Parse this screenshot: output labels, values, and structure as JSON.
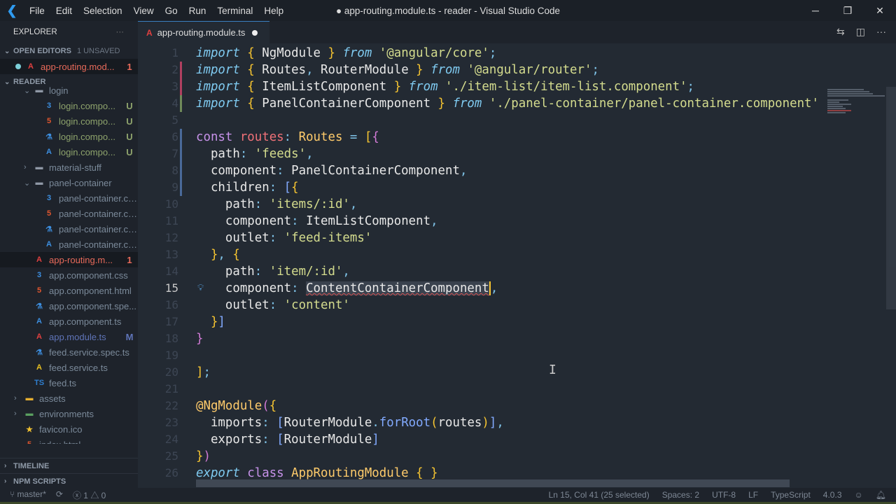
{
  "window": {
    "title": "● app-routing.module.ts - reader - Visual Studio Code",
    "menu": [
      "File",
      "Edit",
      "Selection",
      "View",
      "Go",
      "Run",
      "Terminal",
      "Help"
    ]
  },
  "sidebar": {
    "title": "EXPLORER",
    "more": "···",
    "open_editors": {
      "label": "OPEN EDITORS",
      "badge": "1 UNSAVED",
      "item": {
        "name": "app-routing.mod...",
        "problems": "1"
      }
    },
    "reader_label": "READER",
    "items": [
      {
        "name": "login",
        "indent": 2,
        "type": "folder-open",
        "cls": ""
      },
      {
        "name": "login.compo...",
        "indent": 3,
        "type": "css",
        "status": "U",
        "cls": "untr"
      },
      {
        "name": "login.compo...",
        "indent": 3,
        "type": "html",
        "status": "U",
        "cls": "untr"
      },
      {
        "name": "login.compo...",
        "indent": 3,
        "type": "spec",
        "status": "U",
        "cls": "untr"
      },
      {
        "name": "login.compo...",
        "indent": 3,
        "type": "ng",
        "status": "U",
        "cls": "untr"
      },
      {
        "name": "material-stuff",
        "indent": 2,
        "type": "folder",
        "cls": ""
      },
      {
        "name": "panel-container",
        "indent": 2,
        "type": "folder-open",
        "cls": ""
      },
      {
        "name": "panel-container.co...",
        "indent": 3,
        "type": "css",
        "cls": ""
      },
      {
        "name": "panel-container.co...",
        "indent": 3,
        "type": "html",
        "cls": ""
      },
      {
        "name": "panel-container.co...",
        "indent": 3,
        "type": "spec",
        "cls": ""
      },
      {
        "name": "panel-container.co...",
        "indent": 3,
        "type": "ng",
        "cls": ""
      },
      {
        "name": "app-routing.m...",
        "indent": 2,
        "type": "ngred",
        "status": "1",
        "cls": "err",
        "selected": true
      },
      {
        "name": "app.component.css",
        "indent": 2,
        "type": "css",
        "cls": ""
      },
      {
        "name": "app.component.html",
        "indent": 2,
        "type": "html",
        "cls": ""
      },
      {
        "name": "app.component.spe...",
        "indent": 2,
        "type": "spec",
        "cls": ""
      },
      {
        "name": "app.component.ts",
        "indent": 2,
        "type": "ng",
        "cls": ""
      },
      {
        "name": "app.module.ts",
        "indent": 2,
        "type": "ngred",
        "status": "M",
        "cls": "mod"
      },
      {
        "name": "feed.service.spec.ts",
        "indent": 2,
        "type": "spec",
        "cls": ""
      },
      {
        "name": "feed.service.ts",
        "indent": 2,
        "type": "ngyellow",
        "cls": ""
      },
      {
        "name": "feed.ts",
        "indent": 2,
        "type": "ts",
        "cls": ""
      },
      {
        "name": "assets",
        "indent": 1,
        "type": "folder-yellow",
        "cls": ""
      },
      {
        "name": "environments",
        "indent": 1,
        "type": "folder-green",
        "cls": ""
      },
      {
        "name": "favicon.ico",
        "indent": 1,
        "type": "star",
        "cls": ""
      },
      {
        "name": "index.html",
        "indent": 1,
        "type": "html",
        "cls": ""
      }
    ],
    "timeline": "TIMELINE",
    "npm": "NPM SCRIPTS"
  },
  "tab": {
    "label": "app-routing.module.ts"
  },
  "editor": {
    "lines": [
      [
        [
          "import",
          "kw"
        ],
        [
          " { ",
          "br"
        ],
        [
          "NgModule",
          "id"
        ],
        [
          " } ",
          "br"
        ],
        [
          "from",
          "kw"
        ],
        [
          " '@angular/core'",
          "str"
        ],
        [
          ";",
          "pn"
        ]
      ],
      [
        [
          "import",
          "kw"
        ],
        [
          " { ",
          "br"
        ],
        [
          "Routes",
          "id"
        ],
        [
          ", ",
          "pn"
        ],
        [
          "RouterModule",
          "id"
        ],
        [
          " } ",
          "br"
        ],
        [
          "from",
          "kw"
        ],
        [
          " '@angular/router'",
          "str"
        ],
        [
          ";",
          "pn"
        ]
      ],
      [
        [
          "import",
          "kw"
        ],
        [
          " { ",
          "br"
        ],
        [
          "ItemListComponent",
          "id"
        ],
        [
          " } ",
          "br"
        ],
        [
          "from",
          "kw"
        ],
        [
          " './item-list/item-list.component'",
          "str"
        ],
        [
          ";",
          "pn"
        ]
      ],
      [
        [
          "import",
          "kw"
        ],
        [
          " { ",
          "br"
        ],
        [
          "PanelContainerComponent",
          "id"
        ],
        [
          " } ",
          "br"
        ],
        [
          "from",
          "kw"
        ],
        [
          " './panel-container/panel-container.component'",
          "str"
        ]
      ],
      [],
      [
        [
          "const ",
          "cn"
        ],
        [
          "routes",
          "var"
        ],
        [
          ": ",
          "pn"
        ],
        [
          "Routes",
          "ty"
        ],
        [
          " = ",
          "pn"
        ],
        [
          "[",
          "br"
        ],
        [
          "{",
          "pk"
        ]
      ],
      [
        [
          "  path",
          "id"
        ],
        [
          ": ",
          "pn"
        ],
        [
          "'feeds'",
          "str"
        ],
        [
          ",",
          "pn"
        ]
      ],
      [
        [
          "  component",
          "id"
        ],
        [
          ": ",
          "pn"
        ],
        [
          "PanelContainerComponent",
          "id"
        ],
        [
          ",",
          "pn"
        ]
      ],
      [
        [
          "  children",
          "id"
        ],
        [
          ": ",
          "pn"
        ],
        [
          "[",
          "fn"
        ],
        [
          "{",
          "br"
        ]
      ],
      [
        [
          "    path",
          "id"
        ],
        [
          ": ",
          "pn"
        ],
        [
          "'items/:id'",
          "str"
        ],
        [
          ",",
          "pn"
        ]
      ],
      [
        [
          "    component",
          "id"
        ],
        [
          ": ",
          "pn"
        ],
        [
          "ItemListComponent",
          "id"
        ],
        [
          ",",
          "pn"
        ]
      ],
      [
        [
          "    outlet",
          "id"
        ],
        [
          ": ",
          "pn"
        ],
        [
          "'feed-items'",
          "str"
        ]
      ],
      [
        [
          "  }",
          "br"
        ],
        [
          ", ",
          "pn"
        ],
        [
          "{",
          "br"
        ]
      ],
      [
        [
          "    path",
          "id"
        ],
        [
          ": ",
          "pn"
        ],
        [
          "'item/:id'",
          "str"
        ],
        [
          ",",
          "pn"
        ]
      ],
      [
        [
          "    component",
          "id"
        ],
        [
          ": ",
          "pn"
        ],
        [
          "ContentContainerComponent",
          "id sq"
        ],
        [
          "|",
          "cur"
        ],
        [
          ",",
          "pn"
        ]
      ],
      [
        [
          "    outlet",
          "id"
        ],
        [
          ": ",
          "pn"
        ],
        [
          "'content'",
          "str"
        ]
      ],
      [
        [
          "  }",
          "br"
        ],
        [
          "]",
          "fn"
        ]
      ],
      [
        [
          "}",
          "pk"
        ]
      ],
      [],
      [
        [
          "]",
          "br"
        ],
        [
          ";",
          "pn"
        ]
      ],
      [],
      [
        [
          "@NgModule",
          "ty"
        ],
        [
          "(",
          "pk"
        ],
        [
          "{",
          "br"
        ]
      ],
      [
        [
          "  imports",
          "id"
        ],
        [
          ": ",
          "pn"
        ],
        [
          "[",
          "fn"
        ],
        [
          "RouterModule",
          "id"
        ],
        [
          ".",
          "pn"
        ],
        [
          "forRoot",
          "fn"
        ],
        [
          "(",
          "br"
        ],
        [
          "routes",
          "id"
        ],
        [
          ")",
          "br"
        ],
        [
          "]",
          "fn"
        ],
        [
          ",",
          "pn"
        ]
      ],
      [
        [
          "  exports",
          "id"
        ],
        [
          ": ",
          "pn"
        ],
        [
          "[",
          "fn"
        ],
        [
          "RouterModule",
          "id"
        ],
        [
          "]",
          "fn"
        ]
      ],
      [
        [
          "}",
          "br"
        ],
        [
          ")",
          "pk"
        ]
      ],
      [
        [
          "export",
          "kw"
        ],
        [
          " class ",
          "cn"
        ],
        [
          "AppRoutingModule",
          "ty"
        ],
        [
          " { }",
          "br"
        ]
      ]
    ]
  },
  "status": {
    "branch": "master*",
    "errors": "1",
    "warnings": "0",
    "position": "Ln 15, Col 41 (25 selected)",
    "spaces": "Spaces: 2",
    "encoding": "UTF-8",
    "eol": "LF",
    "language": "TypeScript",
    "version": "4.0.3"
  }
}
